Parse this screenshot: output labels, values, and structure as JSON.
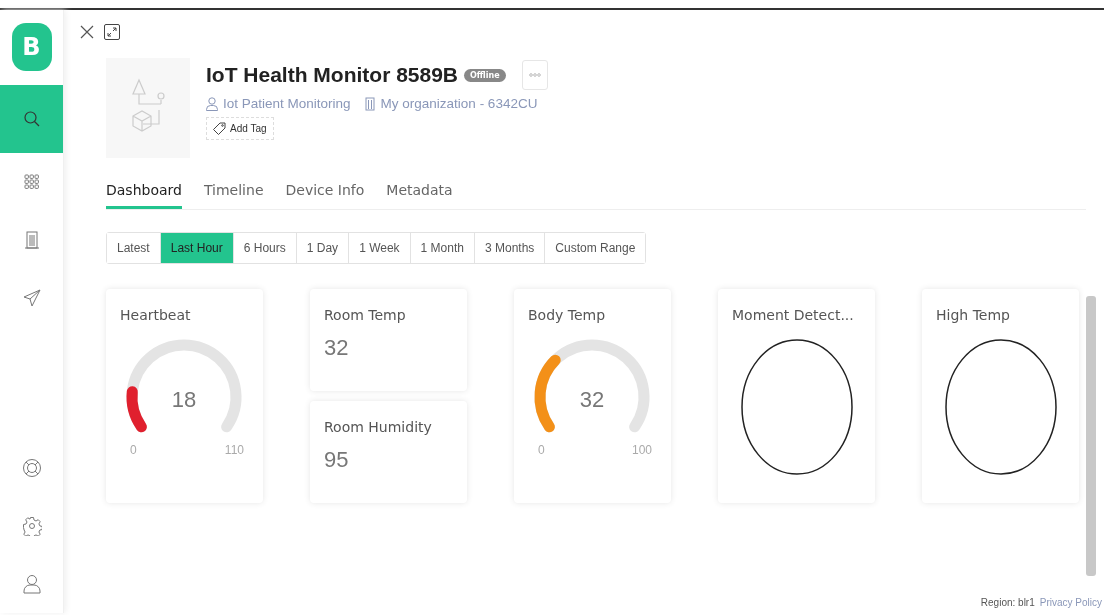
{
  "sidebar": {
    "logo": "B",
    "items": [
      {
        "selected": true
      },
      {
        "selected": false
      },
      {
        "selected": false
      },
      {
        "selected": false
      },
      {
        "selected": false
      },
      {
        "selected": false
      },
      {
        "selected": false
      }
    ]
  },
  "device": {
    "title": "IoT Health Monitor 8589B",
    "status": "Offline",
    "owner": "Iot Patient Monitoring",
    "organization": "My organization - 6342CU",
    "add_tag": "Add Tag"
  },
  "tabs": [
    {
      "label": "Dashboard",
      "selected": true
    },
    {
      "label": "Timeline",
      "selected": false
    },
    {
      "label": "Device Info",
      "selected": false
    },
    {
      "label": "Metadata",
      "selected": false
    }
  ],
  "ranges": [
    {
      "label": "Latest",
      "selected": false
    },
    {
      "label": "Last Hour",
      "selected": true
    },
    {
      "label": "6 Hours",
      "selected": false
    },
    {
      "label": "1 Day",
      "selected": false
    },
    {
      "label": "1 Week",
      "selected": false
    },
    {
      "label": "1 Month",
      "selected": false
    },
    {
      "label": "3 Months",
      "selected": false
    },
    {
      "label": "Custom Range",
      "selected": false
    }
  ],
  "widgets": [
    {
      "kind": "gauge",
      "title": "Heartbeat",
      "value": "18",
      "min": "0",
      "max": "110",
      "color": "#e0202e"
    },
    {
      "kind": "stack",
      "items": [
        {
          "title": "Room Temp",
          "value": "32"
        },
        {
          "title": "Room Humidity",
          "value": "95"
        }
      ]
    },
    {
      "kind": "gauge",
      "title": "Body Temp",
      "value": "32",
      "min": "0",
      "max": "100",
      "color": "#f39018"
    },
    {
      "kind": "led",
      "title": "Moment Detect..."
    },
    {
      "kind": "led",
      "title": "High Temp"
    }
  ],
  "footer": {
    "region": "Region: blr1",
    "privacy": "Privacy Policy"
  }
}
